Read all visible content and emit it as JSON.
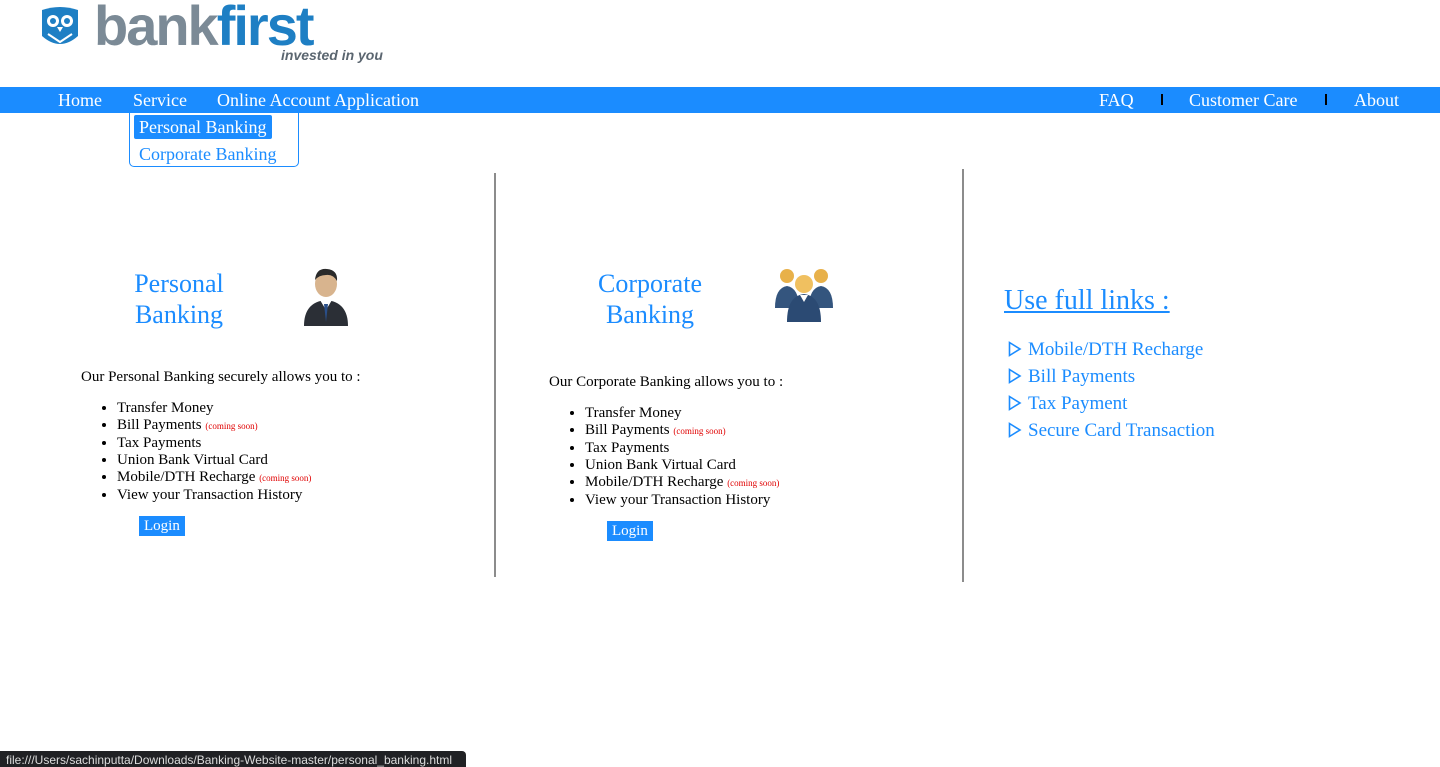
{
  "brand": {
    "name_part1": "bank",
    "name_part2": "first",
    "tagline": "invested in you",
    "colors": {
      "primary": "#1b8cff",
      "logo_gray": "#7b8a96",
      "logo_blue": "#1e7fc4",
      "soon_red": "#e00000"
    }
  },
  "nav": {
    "left": [
      "Home",
      "Service",
      "Online Account Application"
    ],
    "right": [
      "FAQ",
      "Customer Care",
      "About"
    ]
  },
  "dropdown": {
    "items": [
      "Personal Banking",
      "Corporate Banking"
    ],
    "active": "Personal Banking"
  },
  "personal": {
    "title_line1": "Personal",
    "title_line2": "Banking",
    "icon": "businessman-icon",
    "intro": "Our Personal Banking securely allows you to :",
    "features": [
      {
        "text": "Transfer Money",
        "badge": ""
      },
      {
        "text": "Bill Payments",
        "badge": "(coming soon)"
      },
      {
        "text": "Tax Payments",
        "badge": ""
      },
      {
        "text": "Union Bank Virtual Card",
        "badge": ""
      },
      {
        "text": "Mobile/DTH Recharge",
        "badge": "(coming soon)"
      },
      {
        "text": "View your Transaction History",
        "badge": ""
      }
    ],
    "login": "Login"
  },
  "corporate": {
    "title_line1": "Corporate",
    "title_line2": "Banking",
    "icon": "business-group-icon",
    "intro": "Our Corporate Banking allows you to :",
    "features": [
      {
        "text": "Transfer Money",
        "badge": ""
      },
      {
        "text": "Bill Payments",
        "badge": "(coming soon)"
      },
      {
        "text": "Tax Payments",
        "badge": ""
      },
      {
        "text": "Union Bank Virtual Card",
        "badge": ""
      },
      {
        "text": "Mobile/DTH Recharge",
        "badge": "(coming soon)"
      },
      {
        "text": "View your Transaction History",
        "badge": ""
      }
    ],
    "login": "Login"
  },
  "useful_links": {
    "title": "Use full links :",
    "items": [
      "Mobile/DTH Recharge",
      "Bill Payments",
      "Tax Payment",
      "Secure Card Transaction"
    ],
    "icon": "triangle-right-outline-icon"
  },
  "statusbar": {
    "url": "file:///Users/sachinputta/Downloads/Banking-Website-master/personal_banking.html"
  }
}
